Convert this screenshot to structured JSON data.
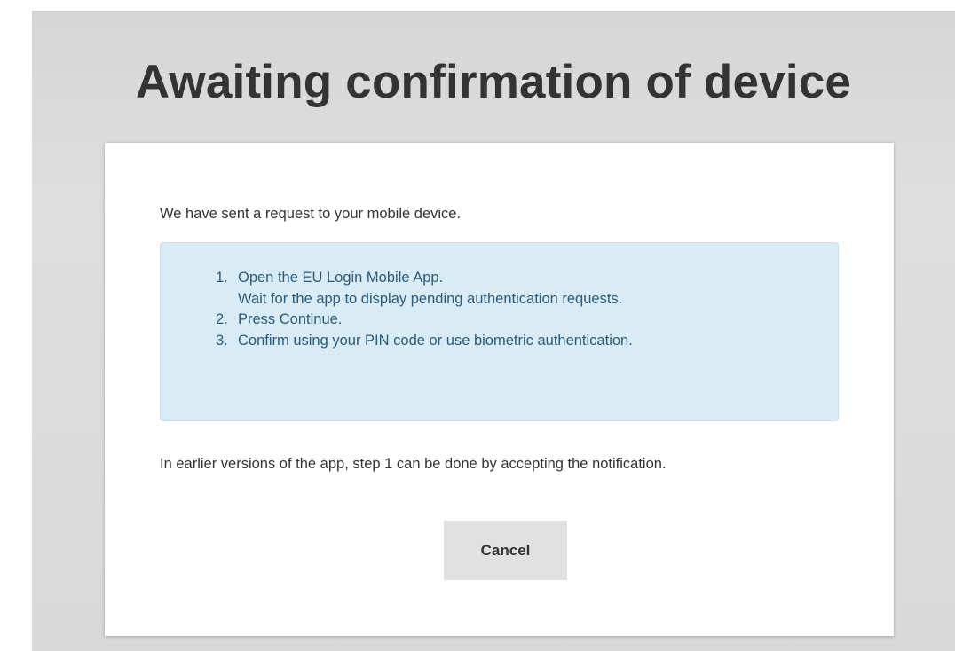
{
  "page": {
    "title": "Awaiting confirmation of device"
  },
  "card": {
    "intro": "We have sent a request to your mobile device.",
    "steps": [
      {
        "number": "1.",
        "lines": [
          "Open the EU Login Mobile App.",
          "Wait for the app to display pending authentication requests."
        ]
      },
      {
        "number": "2.",
        "lines": [
          "Press Continue."
        ]
      },
      {
        "number": "3.",
        "lines": [
          "Confirm using your PIN code or use biometric authentication."
        ]
      }
    ],
    "note": "In earlier versions of the app, step 1 can be done by accepting the notification.",
    "cancel_label": "Cancel"
  },
  "colors": {
    "backdrop": "#d9d9d9",
    "info_box": "#d9ebf4",
    "info_text": "#2b5a7a",
    "button": "#e1e1e1",
    "text": "#333333"
  }
}
